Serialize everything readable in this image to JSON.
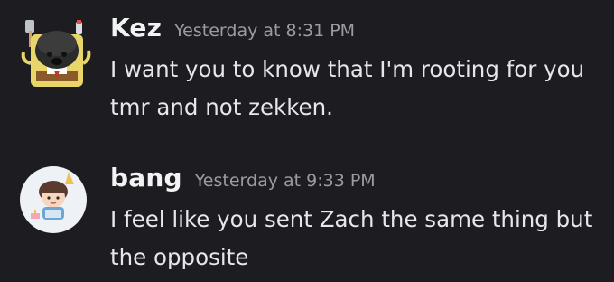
{
  "messages": [
    {
      "username": "Kez",
      "timestamp": "Yesterday at 8:31 PM",
      "text": "I want you to know that I'm rooting for you tmr and not zekken.",
      "avatar_icon": "dog-sponge-avatar"
    },
    {
      "username": "bang",
      "timestamp": "Yesterday at 9:33 PM",
      "text": "I feel like you sent Zach the same thing but the opposite",
      "avatar_icon": "cartoon-boy-avatar"
    }
  ],
  "colors": {
    "background": "#1d1d21",
    "username": "#f2f3f5",
    "timestamp": "#9a9ca3",
    "message_text": "#e6e7ea"
  }
}
